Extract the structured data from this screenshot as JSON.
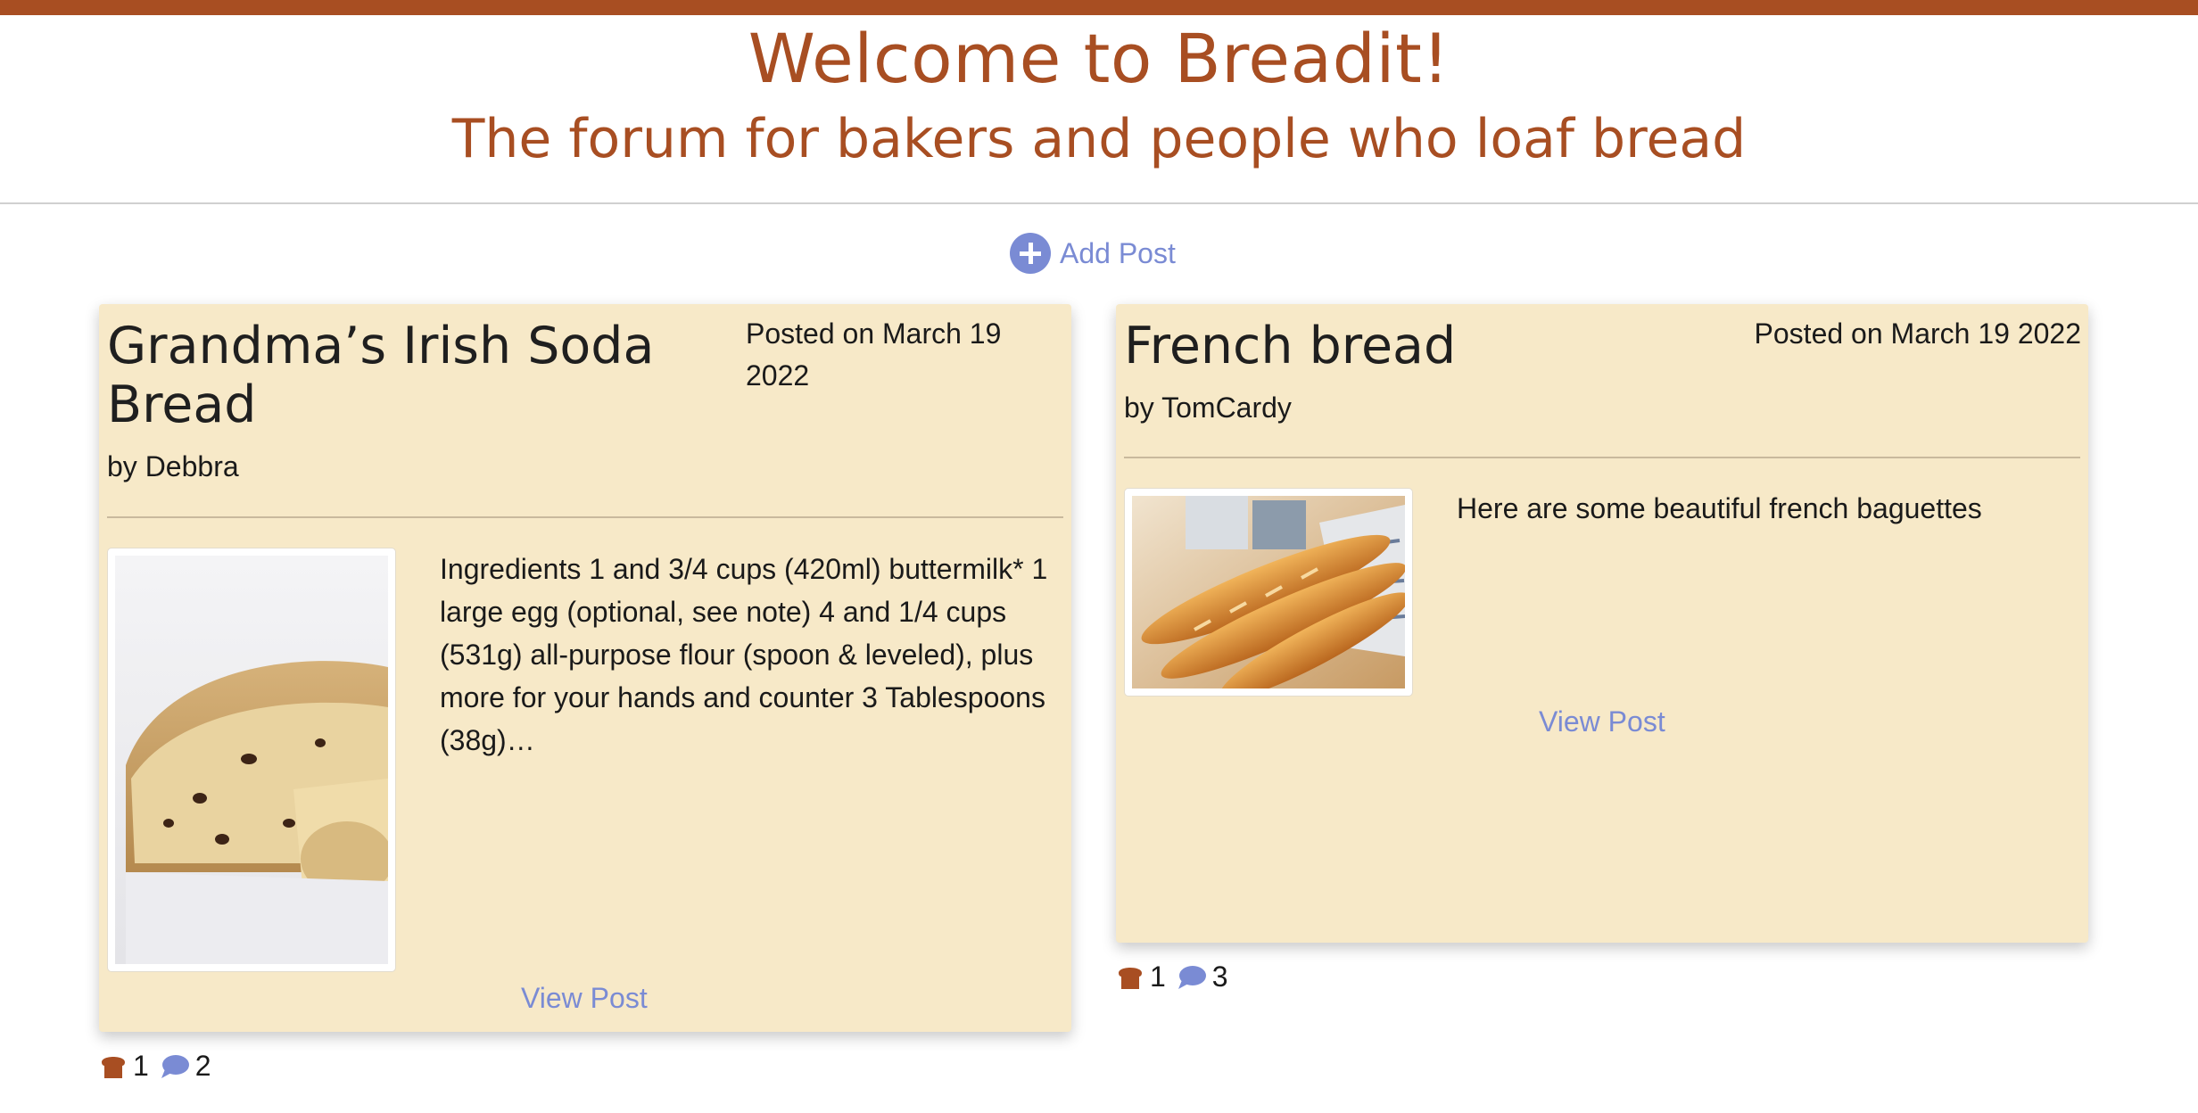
{
  "header": {
    "title": "Welcome to Breadit!",
    "subtitle": "The forum for bakers and people who loaf bread"
  },
  "add_post": {
    "label": "Add Post",
    "icon": "plus-circle-icon"
  },
  "colors": {
    "brand": "#a84e22",
    "card_background": "#f7e9c8",
    "link": "#7a8bd4"
  },
  "posts": [
    {
      "title": "Grandma’s Irish Soda Bread",
      "date": "Posted on March 19 2022",
      "author": "by Debbra",
      "excerpt": "Ingredients 1 and 3/4 cups (420ml) buttermilk* 1 large egg (optional, see note) 4 and 1/4 cups (531g) all-purpose flour (spoon & leveled), plus more for your hands and counter 3 Tablespoons (38g)…",
      "image": "irish-soda-bread-photo",
      "view_label": "View Post",
      "likes": "1",
      "comments": "2"
    },
    {
      "title": "French bread",
      "date": "Posted on March 19 2022",
      "author": "by TomCardy",
      "excerpt": "Here are some beautiful french baguettes",
      "image": "french-baguettes-photo",
      "view_label": "View Post",
      "likes": "1",
      "comments": "3"
    }
  ]
}
